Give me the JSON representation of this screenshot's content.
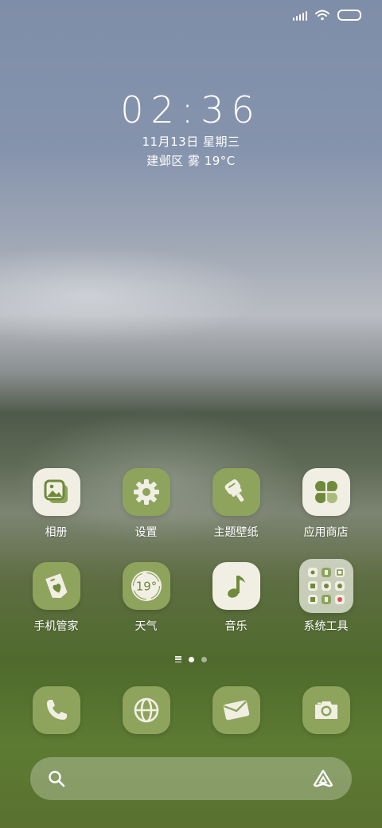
{
  "clock": {
    "time": "02:36",
    "date": "11月13日 星期三",
    "weather": "建邺区 雾 19°C"
  },
  "apps": [
    {
      "label": "相册",
      "icon": "gallery-icon"
    },
    {
      "label": "设置",
      "icon": "gear-icon"
    },
    {
      "label": "主题壁纸",
      "icon": "paint-roller-icon"
    },
    {
      "label": "应用商店",
      "icon": "app-store-icon"
    },
    {
      "label": "手机管家",
      "icon": "security-icon"
    },
    {
      "label": "天气",
      "icon": "weather-icon",
      "badge": "19°"
    },
    {
      "label": "音乐",
      "icon": "music-note-icon"
    },
    {
      "label": "系统工具",
      "icon": "folder-icon"
    }
  ],
  "dock": [
    {
      "icon": "phone-icon"
    },
    {
      "icon": "browser-icon"
    },
    {
      "icon": "messages-icon"
    },
    {
      "icon": "camera-icon"
    }
  ],
  "pager": {
    "pages": 2,
    "active": 1
  },
  "search": {
    "placeholder": ""
  },
  "colors": {
    "icon_green": "#8ea45d",
    "icon_cream": "#f1efe3",
    "glyph_green": "#6f8a3b"
  }
}
